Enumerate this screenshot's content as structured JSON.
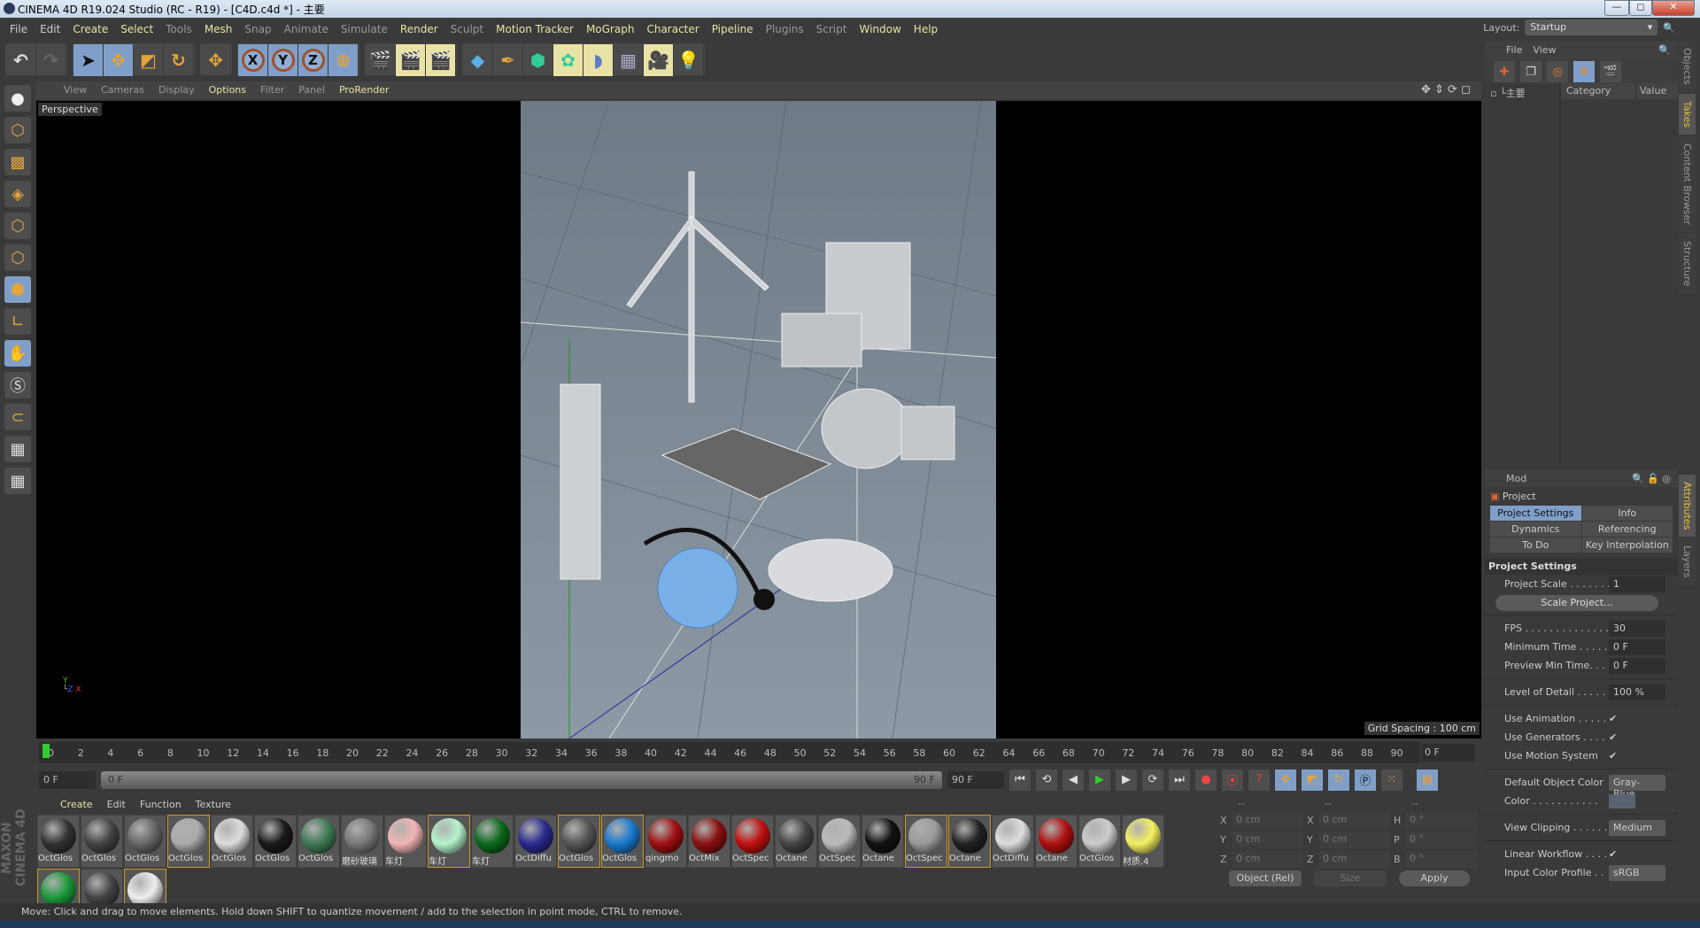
{
  "window": {
    "title": "CINEMA 4D R19.024 Studio (RC - R19) - [C4D.c4d *] - 主要",
    "minimize": "—",
    "maximize": "◻",
    "close": "✕"
  },
  "menu": [
    {
      "label": "File",
      "s": ""
    },
    {
      "label": "Edit",
      "s": ""
    },
    {
      "label": "Create",
      "s": "hl"
    },
    {
      "label": "Select",
      "s": "hl"
    },
    {
      "label": "Tools",
      "s": "dim"
    },
    {
      "label": "Mesh",
      "s": "hl"
    },
    {
      "label": "Snap",
      "s": "dim"
    },
    {
      "label": "Animate",
      "s": "dim"
    },
    {
      "label": "Simulate",
      "s": "dim"
    },
    {
      "label": "Render",
      "s": "hl"
    },
    {
      "label": "Sculpt",
      "s": "dim"
    },
    {
      "label": "Motion Tracker",
      "s": "hl"
    },
    {
      "label": "MoGraph",
      "s": "hl"
    },
    {
      "label": "Character",
      "s": "hl"
    },
    {
      "label": "Pipeline",
      "s": "hl"
    },
    {
      "label": "Plugins",
      "s": "dim"
    },
    {
      "label": "Script",
      "s": "dim"
    },
    {
      "label": "Window",
      "s": "hl"
    },
    {
      "label": "Help",
      "s": "hl"
    }
  ],
  "layout": {
    "label": "Layout:",
    "value": "Startup"
  },
  "toolbar": {
    "axes": [
      "X",
      "Y",
      "Z"
    ]
  },
  "viewport": {
    "menu": [
      {
        "label": "View",
        "s": ""
      },
      {
        "label": "Cameras",
        "s": ""
      },
      {
        "label": "Display",
        "s": ""
      },
      {
        "label": "Options",
        "s": "hl"
      },
      {
        "label": "Filter",
        "s": ""
      },
      {
        "label": "Panel",
        "s": ""
      },
      {
        "label": "ProRender",
        "s": "hl"
      }
    ],
    "camera": "Perspective",
    "grid_spacing": "Grid Spacing : 100 cm"
  },
  "timeline": {
    "ticks": [
      "0",
      "2",
      "4",
      "6",
      "8",
      "10",
      "12",
      "14",
      "16",
      "18",
      "20",
      "22",
      "24",
      "26",
      "28",
      "30",
      "32",
      "34",
      "36",
      "38",
      "40",
      "42",
      "44",
      "46",
      "48",
      "50",
      "52",
      "54",
      "56",
      "58",
      "60",
      "62",
      "64",
      "66",
      "68",
      "70",
      "72",
      "74",
      "76",
      "78",
      "80",
      "82",
      "84",
      "86",
      "88",
      "90"
    ],
    "current": "0 F",
    "start": "0 F",
    "range_start": "0 F",
    "range_end": "90 F",
    "end": "90 F"
  },
  "materials": {
    "menu": [
      {
        "label": "Create",
        "s": "hl"
      },
      {
        "label": "Edit",
        "s": ""
      },
      {
        "label": "Function",
        "s": ""
      },
      {
        "label": "Texture",
        "s": ""
      }
    ],
    "items": [
      {
        "name": "OctGlos",
        "color": "#333",
        "sel": false
      },
      {
        "name": "OctGlos",
        "color": "#444",
        "sel": false
      },
      {
        "name": "OctGlos",
        "color": "#666",
        "sel": false
      },
      {
        "name": "OctGlos",
        "color": "#aaa",
        "sel": true
      },
      {
        "name": "OctGlos",
        "color": "#ddd",
        "sel": false
      },
      {
        "name": "OctGlos",
        "color": "#1a1a1a",
        "sel": false
      },
      {
        "name": "OctGlos",
        "color": "#3f7a55",
        "sel": false
      },
      {
        "name": "磨砂玻璃",
        "color": "#777",
        "sel": false
      },
      {
        "name": "车灯",
        "color": "#f3b4b4",
        "sel": false
      },
      {
        "name": "车灯",
        "color": "#b4f3cc",
        "sel": true
      },
      {
        "name": "车灯",
        "color": "#0a6a1a",
        "sel": false
      },
      {
        "name": "OctDiffu",
        "color": "#2a2a90",
        "sel": false
      },
      {
        "name": "OctGlos",
        "color": "#555",
        "sel": true
      },
      {
        "name": "OctGlos",
        "color": "#1a7ad0",
        "sel": true
      },
      {
        "name": "qingmo",
        "color": "#a01010",
        "sel": false
      },
      {
        "name": "OctMix",
        "color": "#8a1010",
        "sel": false
      },
      {
        "name": "OctSpec",
        "color": "#c01010",
        "sel": false
      },
      {
        "name": "Octane",
        "color": "#444",
        "sel": false
      },
      {
        "name": "OctSpec",
        "color": "#bbb",
        "sel": false
      },
      {
        "name": "Octane",
        "color": "#111",
        "sel": false
      },
      {
        "name": "OctSpec",
        "color": "#999",
        "sel": true
      },
      {
        "name": "Octane",
        "color": "#222",
        "sel": true
      },
      {
        "name": "OctDiffu",
        "color": "#ddd",
        "sel": false
      },
      {
        "name": "Octane",
        "color": "#b01010",
        "sel": false
      },
      {
        "name": "OctGlos",
        "color": "#ccc",
        "sel": false
      },
      {
        "name": "材质.4",
        "color": "#f5f060",
        "sel": false
      },
      {
        "name": "",
        "color": "#1a9a3a",
        "sel": true
      },
      {
        "name": "",
        "color": "#444",
        "sel": false
      },
      {
        "name": "",
        "color": "#eee",
        "sel": true
      }
    ]
  },
  "brand": "MAXON CINEMA 4D",
  "coords": {
    "headers": [
      "--",
      "--",
      "--"
    ],
    "rows": [
      {
        "a": "X",
        "av": "0 cm",
        "b": "X",
        "bv": "0 cm",
        "c": "H",
        "cv": "0 °"
      },
      {
        "a": "Y",
        "av": "0 cm",
        "b": "Y",
        "bv": "0 cm",
        "c": "P",
        "cv": "0 °"
      },
      {
        "a": "Z",
        "av": "0 cm",
        "b": "Z",
        "bv": "0 cm",
        "c": "B",
        "cv": "0 °"
      }
    ],
    "mode": "Object (Rel)",
    "size": "Size",
    "apply": "Apply"
  },
  "status": "Move: Click and drag to move elements. Hold down SHIFT to quantize movement / add to the selection in point mode, CTRL to remove.",
  "takes": {
    "menu": [
      "File",
      "View"
    ],
    "take": "主要",
    "columns": [
      "Category",
      "Value"
    ]
  },
  "attributes": {
    "mode": "Mod",
    "object": "Project",
    "tabs": [
      {
        "label": "Project Settings",
        "on": true
      },
      {
        "label": "Info",
        "on": false
      },
      {
        "label": "Dynamics",
        "on": false
      },
      {
        "label": "Referencing",
        "on": false
      },
      {
        "label": "To Do",
        "on": false
      },
      {
        "label": "Key Interpolation",
        "on": false
      }
    ],
    "section": "Project Settings",
    "project_scale": {
      "label": "Project Scale . . . . . . .",
      "value": "1"
    },
    "scale_button": "Scale Project...",
    "fps": {
      "label": "FPS . . . . . . . . . . . . . . .",
      "value": "30"
    },
    "min_time": {
      "label": "Minimum Time . . . . .",
      "value": "0 F"
    },
    "preview_min": {
      "label": "Preview Min Time. . .",
      "value": "0 F"
    },
    "lod": {
      "label": "Level of Detail . . . . . .",
      "value": "100 %"
    },
    "use_animation": {
      "label": "Use Animation . . . . .",
      "checked": true
    },
    "use_generators": {
      "label": "Use Generators . . . . .",
      "checked": true
    },
    "use_motion": {
      "label": "Use Motion System",
      "checked": true
    },
    "default_color": {
      "label": "Default Object Color",
      "value": "Gray-Blue"
    },
    "color": {
      "label": "Color . . . . . . . . . . .",
      "value": "#5a6470"
    },
    "view_clipping": {
      "label": "View Clipping . . . . . .",
      "value": "Medium"
    },
    "linear": {
      "label": "Linear Workflow . . . .",
      "checked": true
    },
    "input_profile": {
      "label": "Input Color Profile . .",
      "value": "sRGB"
    },
    "check": "✔"
  },
  "side_tabs": [
    {
      "label": "Objects",
      "on": false
    },
    {
      "label": "Takes",
      "on": true
    },
    {
      "label": "Content Browser",
      "on": false
    },
    {
      "label": "Structure",
      "on": false
    }
  ],
  "side_tabs2": [
    {
      "label": "Attributes",
      "on": true
    },
    {
      "label": "Layers",
      "on": false
    }
  ]
}
